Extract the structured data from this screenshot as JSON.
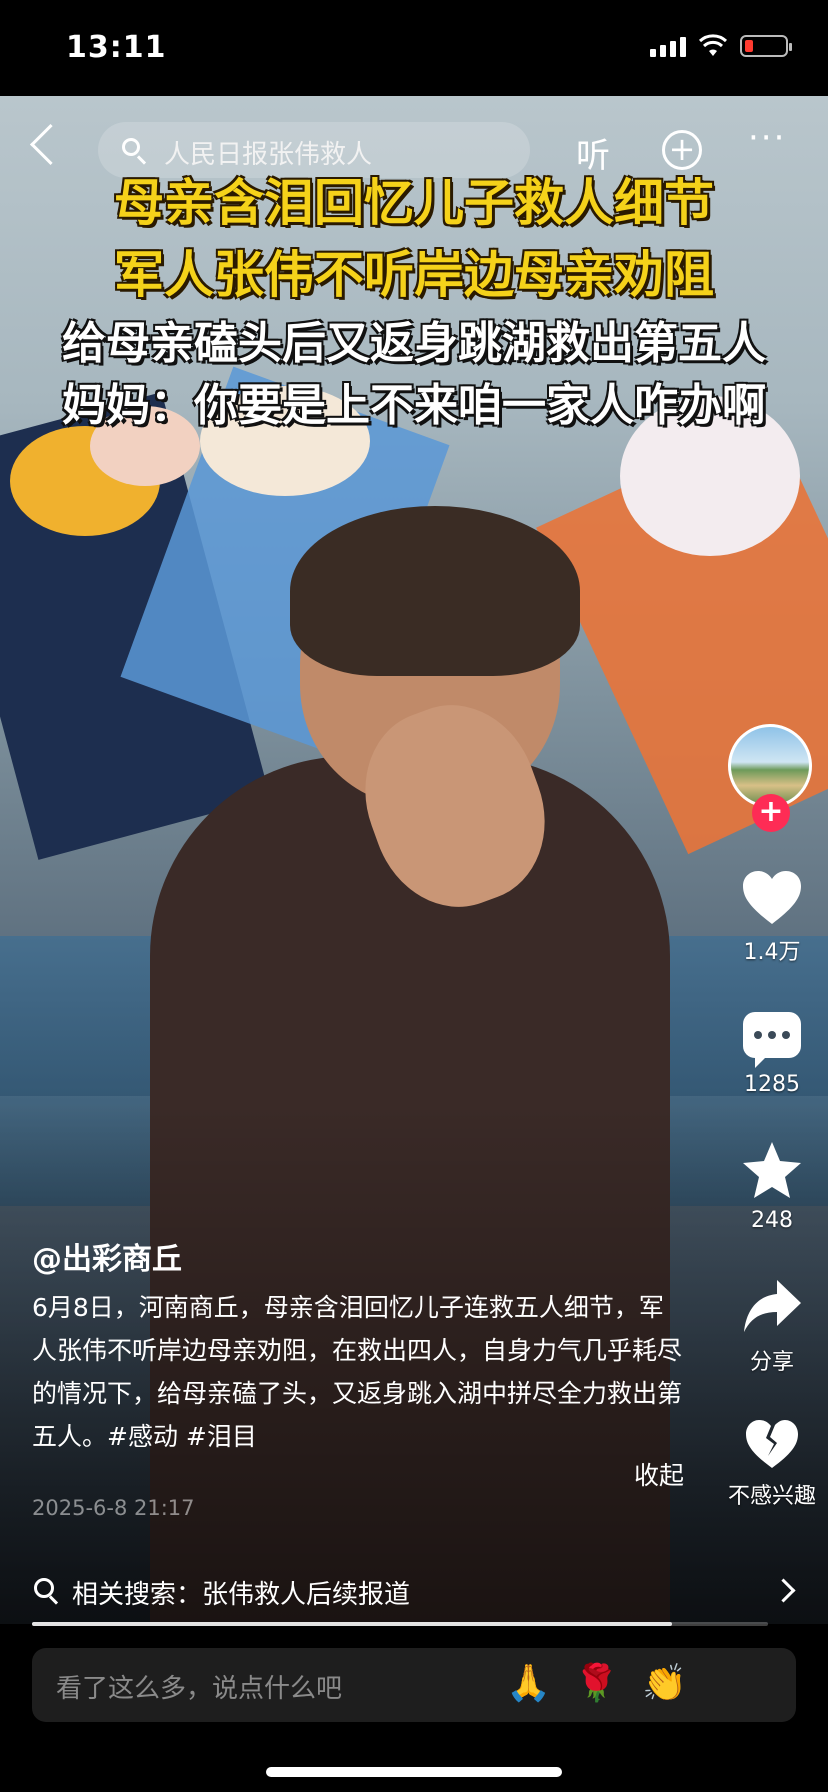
{
  "status": {
    "time": "13:11"
  },
  "topnav": {
    "search_text": "人民日报张伟救人",
    "listen_label": "听",
    "more_label": "···"
  },
  "captions": {
    "line1": "母亲含泪回忆儿子救人细节",
    "line2": "军人张伟不听岸边母亲劝阻",
    "line3": "给母亲磕头后又返身跳湖救出第五人",
    "line4": "妈妈：你要是上不来咱一家人咋办啊"
  },
  "rail": {
    "follow_label": "+",
    "like_count": "1.4万",
    "comment_count": "1285",
    "favorite_count": "248",
    "share_label": "分享",
    "not_interested_label": "不感兴趣"
  },
  "post": {
    "author": "@出彩商丘",
    "description": "6月8日，河南商丘，母亲含泪回忆儿子连救五人细节，军人张伟不听岸边母亲劝阻，在救出四人，自身力气几乎耗尽的情况下，给母亲磕了头，又返身跳入湖中拼尽全力救出第五人。#感动 #泪目",
    "collapse_label": "收起",
    "timestamp": "2025-6-8 21:17"
  },
  "related": {
    "text": "相关搜索：张伟救人后续报道"
  },
  "progress": {
    "value": 0.87
  },
  "comment_input": {
    "placeholder": "看了这么多，说点什么吧",
    "emojis": [
      "🙏",
      "🌹",
      "👏"
    ]
  },
  "colors": {
    "accent_red": "#fe2c55",
    "caption_yellow": "#f5d21a"
  },
  "icons": [
    "back-icon",
    "search-icon",
    "add-circle-icon",
    "heart-icon",
    "comment-icon",
    "star-icon",
    "share-arrow-icon",
    "broken-heart-icon",
    "chevron-right-icon"
  ]
}
